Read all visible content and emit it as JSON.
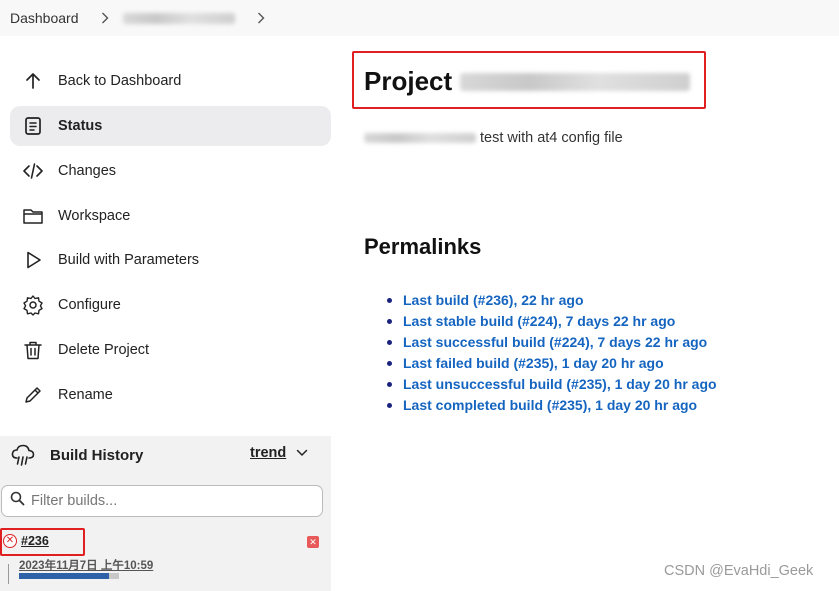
{
  "breadcrumb": {
    "dashboard": "Dashboard"
  },
  "sidebar": {
    "items": [
      {
        "label": "Back to Dashboard",
        "icon": "arrow-up-icon"
      },
      {
        "label": "Status",
        "icon": "document-icon",
        "active": true
      },
      {
        "label": "Changes",
        "icon": "code-icon"
      },
      {
        "label": "Workspace",
        "icon": "folder-icon"
      },
      {
        "label": "Build with Parameters",
        "icon": "play-icon"
      },
      {
        "label": "Configure",
        "icon": "gear-icon"
      },
      {
        "label": "Delete Project",
        "icon": "trash-icon"
      },
      {
        "label": "Rename",
        "icon": "pencil-icon"
      }
    ]
  },
  "build_history": {
    "title": "Build History",
    "trend_label": "trend",
    "filter_placeholder": "Filter builds...",
    "builds": [
      {
        "number": "#236",
        "time": "2023年11月7日 上午10:59",
        "status": "failed",
        "progress": 0.9
      }
    ]
  },
  "main": {
    "title_prefix": "Project",
    "description_suffix": "test with at4 config file",
    "permalinks_title": "Permalinks",
    "permalinks": [
      "Last build (#236), 22 hr ago",
      "Last stable build (#224), 7 days 22 hr ago",
      "Last successful build (#224), 7 days 22 hr ago",
      "Last failed build (#235), 1 day 20 hr ago",
      "Last unsuccessful build (#235), 1 day 20 hr ago",
      "Last completed build (#235), 1 day 20 hr ago"
    ]
  },
  "watermark": "CSDN @EvaHdi_Geek",
  "colors": {
    "link": "#1565c0",
    "highlight_box": "#e02020",
    "failed": "#dd2222",
    "active_bg": "#ececee"
  }
}
